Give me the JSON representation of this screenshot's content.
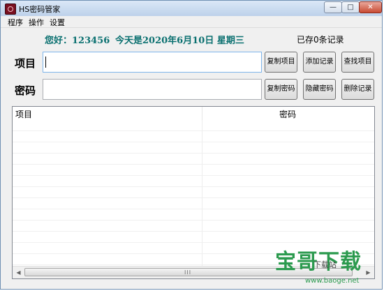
{
  "window": {
    "title": "HS密码管家",
    "controls": {
      "minimize": "—",
      "maximize": "□",
      "close": "✕"
    }
  },
  "menu": [
    {
      "label": "程序"
    },
    {
      "label": "操作"
    },
    {
      "label": "设置"
    }
  ],
  "greeting": "您好：123456",
  "date_text": "今天是2020年6月10日 星期三",
  "record_count": "已存0条记录",
  "fields": {
    "item": {
      "label": "项目",
      "value": ""
    },
    "password": {
      "label": "密码",
      "value": ""
    }
  },
  "buttons": {
    "copy_item": "复制项目",
    "add_record": "添加记录",
    "find_item": "查找项目",
    "copy_password": "复制密码",
    "hide_password": "隐藏密码",
    "delete_record": "删除记录"
  },
  "list": {
    "columns": [
      "项目",
      "密码"
    ],
    "rows": [],
    "scrollbar": {
      "left_arrow": "◀",
      "right_arrow": "▶",
      "grip": "III"
    }
  },
  "watermark": {
    "brand": "宝哥下载",
    "sub": "下载站",
    "url": "www.baoge.net"
  }
}
